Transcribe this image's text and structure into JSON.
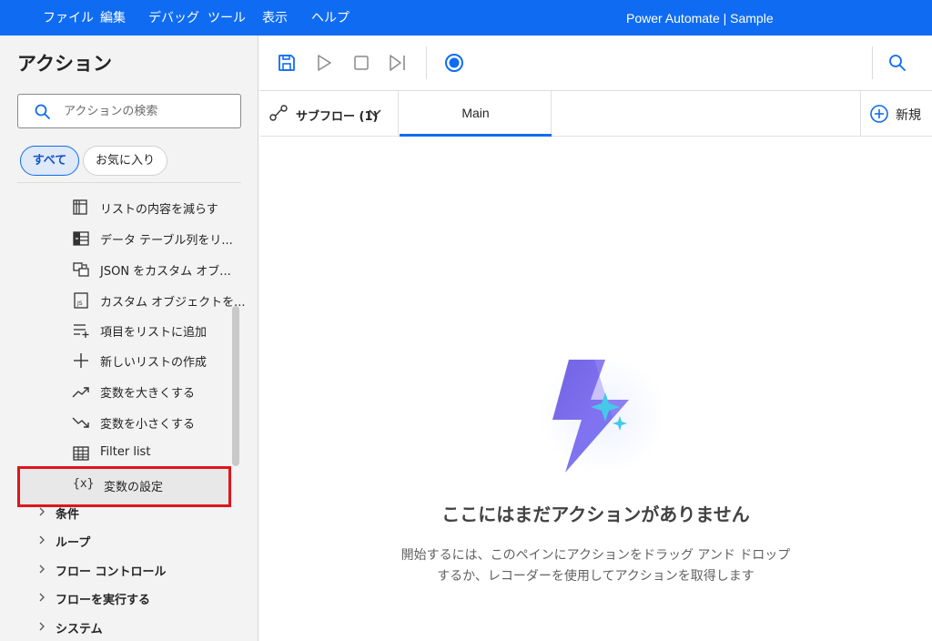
{
  "menubar": {
    "items": [
      "ファイル",
      "編集",
      "デバッグ",
      "ツール",
      "表示",
      "ヘルプ"
    ],
    "title": "Power Automate | Sample",
    "bg_color": "#0f6cf2"
  },
  "actions_pane": {
    "title": "アクション",
    "search_placeholder": "アクションの検索",
    "filters": {
      "all": "すべて",
      "favorites": "お気に入り"
    },
    "items": [
      {
        "label": "リストの内容を減らす",
        "icon": "list-subtract-icon"
      },
      {
        "label": "データ テーブル列をリ...",
        "icon": "table-column-icon"
      },
      {
        "label": "JSON をカスタム オブ...",
        "icon": "json-convert-icon"
      },
      {
        "label": "カスタム オブジェクトを...",
        "icon": "js-file-icon"
      },
      {
        "label": "項目をリストに追加",
        "icon": "list-add-icon"
      },
      {
        "label": "新しいリストの作成",
        "icon": "plus-icon"
      },
      {
        "label": "変数を大きくする",
        "icon": "trend-up-icon"
      },
      {
        "label": "変数を小さくする",
        "icon": "trend-down-icon"
      },
      {
        "label": "Filter list",
        "icon": "grid-table-icon"
      }
    ],
    "highlighted_item": {
      "label": "変数の設定",
      "icon_text": "{x}"
    },
    "groups": [
      "条件",
      "ループ",
      "フロー コントロール",
      "フローを実行する",
      "システム"
    ]
  },
  "toolbar": {
    "buttons": [
      "save-icon",
      "run-icon",
      "stop-icon",
      "run-next-icon",
      "record-icon",
      "search-icon"
    ],
    "accent_color": "#0f6cf2"
  },
  "tabs": {
    "subflow_label": "サブフロー (1)",
    "main_label": "Main",
    "new_label": "新規"
  },
  "canvas": {
    "empty_title": "ここにはまだアクションがありません",
    "empty_desc_line1": "開始するには、このペインにアクションをドラッグ アンド ドロップ",
    "empty_desc_line2": "するか、レコーダーを使用してアクションを取得します"
  }
}
